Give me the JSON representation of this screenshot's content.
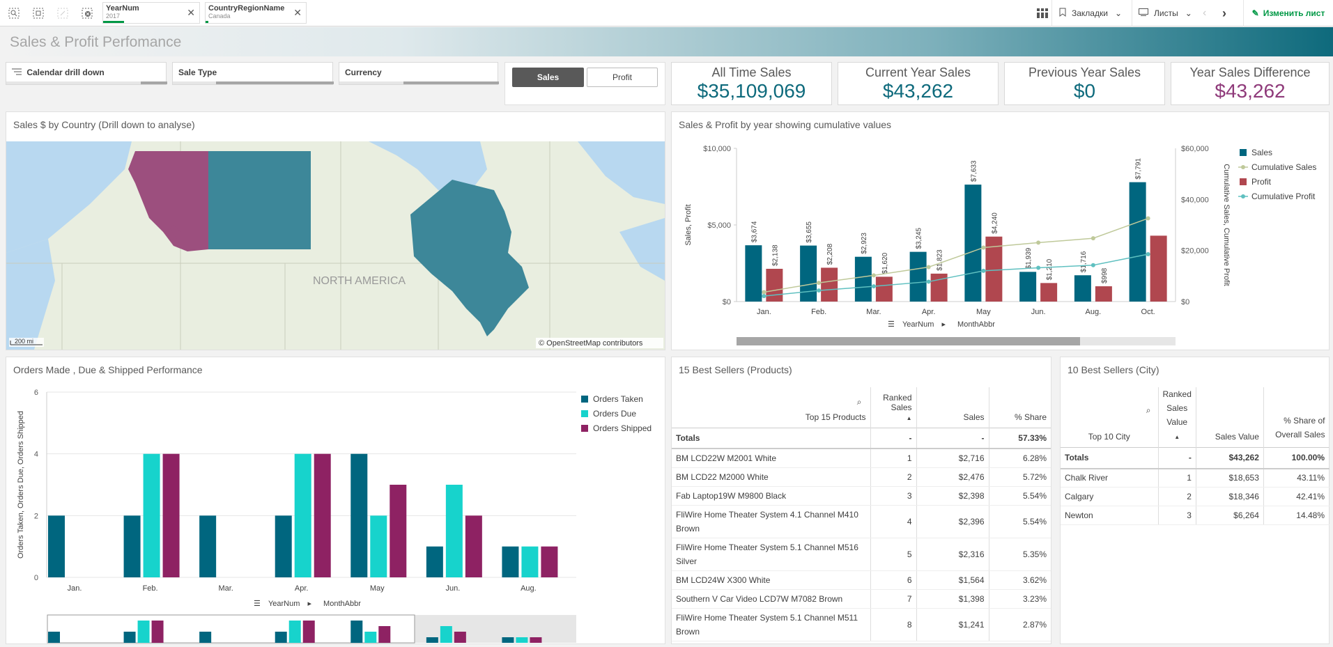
{
  "toolbar": {
    "selections": [
      {
        "field": "YearNum",
        "value": "2017"
      },
      {
        "field": "CountryRegionName",
        "value": "Canada"
      }
    ],
    "bookmarks_label": "Закладки",
    "sheets_label": "Листы",
    "edit_label": "Изменить лист",
    "icons": [
      "smart-search-icon",
      "lasso-select-icon",
      "step-forward-icon",
      "clear-selections-icon",
      "grid-icon",
      "bookmark-icon",
      "sheet-icon",
      "chevron-left-icon",
      "chevron-right-icon",
      "pencil-icon"
    ]
  },
  "page": {
    "title": "Sales & Profit Perfomance"
  },
  "filters": {
    "calendar": "Calendar drill down",
    "sale_type": "Sale Type",
    "currency": "Currency"
  },
  "toggle": {
    "sales": "Sales",
    "profit": "Profit",
    "active": "Sales"
  },
  "kpis": [
    {
      "title": "All Time Sales",
      "value": "$35,109,069",
      "color": "#0e6a7c"
    },
    {
      "title": "Current Year Sales",
      "value": "$43,262",
      "color": "#0e6a7c"
    },
    {
      "title": "Previous Year Sales",
      "value": "$0",
      "color": "#0e6a7c"
    },
    {
      "title": "Year Sales Difference",
      "value": "$43,262",
      "color": "#8f3a7a"
    }
  ],
  "map_panel": {
    "title": "Sales $ by Country (Drill down to analyse)",
    "region_label": "NORTH AMERICA",
    "scale_label": "200 mi",
    "attribution": "© OpenStreetMap contributors",
    "colors": {
      "water": "#b8d8f0",
      "land": "#e9eee0",
      "bc": "#9c4f7e",
      "alberta": "#3d8799",
      "ontario": "#3d8799"
    }
  },
  "combo_chart": {
    "title": "Sales & Profit by year showing cumulative values",
    "dim_label_1": "YearNum",
    "dim_label_2": "MonthAbbr",
    "chart_data": {
      "type": "bar",
      "categories": [
        "Jan.",
        "Feb.",
        "Mar.",
        "Apr.",
        "May",
        "Jun.",
        "Aug.",
        "Oct."
      ],
      "series": [
        {
          "name": "Sales",
          "values": [
            3674,
            3655,
            2923,
            3245,
            7633,
            1939,
            1716,
            7791
          ],
          "labels": [
            "$3,674",
            "$3,655",
            "$2,923",
            "$3,245",
            "$7,633",
            "$1,939",
            "$1,716",
            "$7,791"
          ],
          "color": "#00667f"
        },
        {
          "name": "Profit",
          "values": [
            2138,
            2208,
            1620,
            1823,
            4240,
            1210,
            998,
            4300
          ],
          "labels": [
            "$2,138",
            "$2,208",
            "$1,620",
            "$1,823",
            "$4,240",
            "$1,210",
            "$998",
            ""
          ],
          "color": "#b0474f"
        },
        {
          "name": "Cumulative Sales",
          "values": [
            3674,
            7329,
            10252,
            13497,
            21130,
            23069,
            24785,
            32576
          ],
          "color": "#bfc99a",
          "axis": "right"
        },
        {
          "name": "Cumulative Profit",
          "values": [
            2138,
            4346,
            5966,
            7789,
            12029,
            13239,
            14237,
            18537
          ],
          "color": "#5fc0c0",
          "axis": "right"
        }
      ],
      "ylabel": "Sales, Profit",
      "ylabel_right": "Cumulative Sales, Cumulative Profit",
      "ylim": [
        0,
        10000
      ],
      "ylim_right": [
        0,
        60000
      ],
      "yticks": [
        "$10,000",
        "$5,000",
        "$0"
      ],
      "yticks_right": [
        "$60,000",
        "$40,000",
        "$20,000",
        "$0"
      ],
      "legend": [
        "Sales",
        "Cumulative Sales",
        "Profit",
        "Cumulative Profit"
      ],
      "legend_position": "right"
    }
  },
  "orders_chart": {
    "title": "Orders Made , Due & Shipped Performance",
    "dim_label_1": "YearNum",
    "dim_label_2": "MonthAbbr",
    "chart_data": {
      "type": "bar",
      "categories": [
        "Jan.",
        "Feb.",
        "Mar.",
        "Apr.",
        "May",
        "Jun.",
        "Aug."
      ],
      "series": [
        {
          "name": "Orders Taken",
          "values": [
            2,
            2,
            2,
            2,
            4,
            1,
            1
          ],
          "color": "#00667f"
        },
        {
          "name": "Orders Due",
          "values": [
            0,
            4,
            0,
            4,
            2,
            3,
            1
          ],
          "color": "#17d3cc"
        },
        {
          "name": "Orders Shipped",
          "values": [
            0,
            4,
            0,
            4,
            3,
            2,
            1
          ],
          "color": "#8e2263"
        }
      ],
      "ylabel": "Orders Taken, Orders Due, Orders Shipped",
      "ylim": [
        0,
        6
      ],
      "yticks": [
        "6",
        "4",
        "2",
        "0"
      ],
      "legend_position": "right"
    }
  },
  "products_table": {
    "title": "15 Best Sellers (Products)",
    "headers": [
      "Top 15 Products",
      "Ranked Sales",
      "Sales",
      "% Share"
    ],
    "totals": [
      "Totals",
      "-",
      "-",
      "57.33%"
    ],
    "rows": [
      [
        "BM LCD22W M2001 White",
        "1",
        "$2,716",
        "6.28%"
      ],
      [
        "BM LCD22 M2000 White",
        "2",
        "$2,476",
        "5.72%"
      ],
      [
        "Fab Laptop19W M9800 Black",
        "3",
        "$2,398",
        "5.54%"
      ],
      [
        "FliWire Home Theater System 4.1 Channel M410 Brown",
        "4",
        "$2,396",
        "5.54%"
      ],
      [
        "FliWire Home Theater System 5.1 Channel M516 Silver",
        "5",
        "$2,316",
        "5.35%"
      ],
      [
        "BM LCD24W X300 White",
        "6",
        "$1,564",
        "3.62%"
      ],
      [
        "Southern V Car Video LCD7W M7082 Brown",
        "7",
        "$1,398",
        "3.23%"
      ],
      [
        "FliWire Home Theater System 5.1 Channel M511 Brown",
        "8",
        "$1,241",
        "2.87%"
      ]
    ]
  },
  "city_table": {
    "title": "10 Best Sellers (City)",
    "headers": [
      "Top 10 City",
      "Ranked Sales Value",
      "Sales Value",
      "% Share of Overall Sales"
    ],
    "totals": [
      "Totals",
      "-",
      "$43,262",
      "100.00%"
    ],
    "rows": [
      [
        "Chalk River",
        "1",
        "$18,653",
        "43.11%"
      ],
      [
        "Calgary",
        "2",
        "$18,346",
        "42.41%"
      ],
      [
        "Newton",
        "3",
        "$6,264",
        "14.48%"
      ]
    ]
  }
}
